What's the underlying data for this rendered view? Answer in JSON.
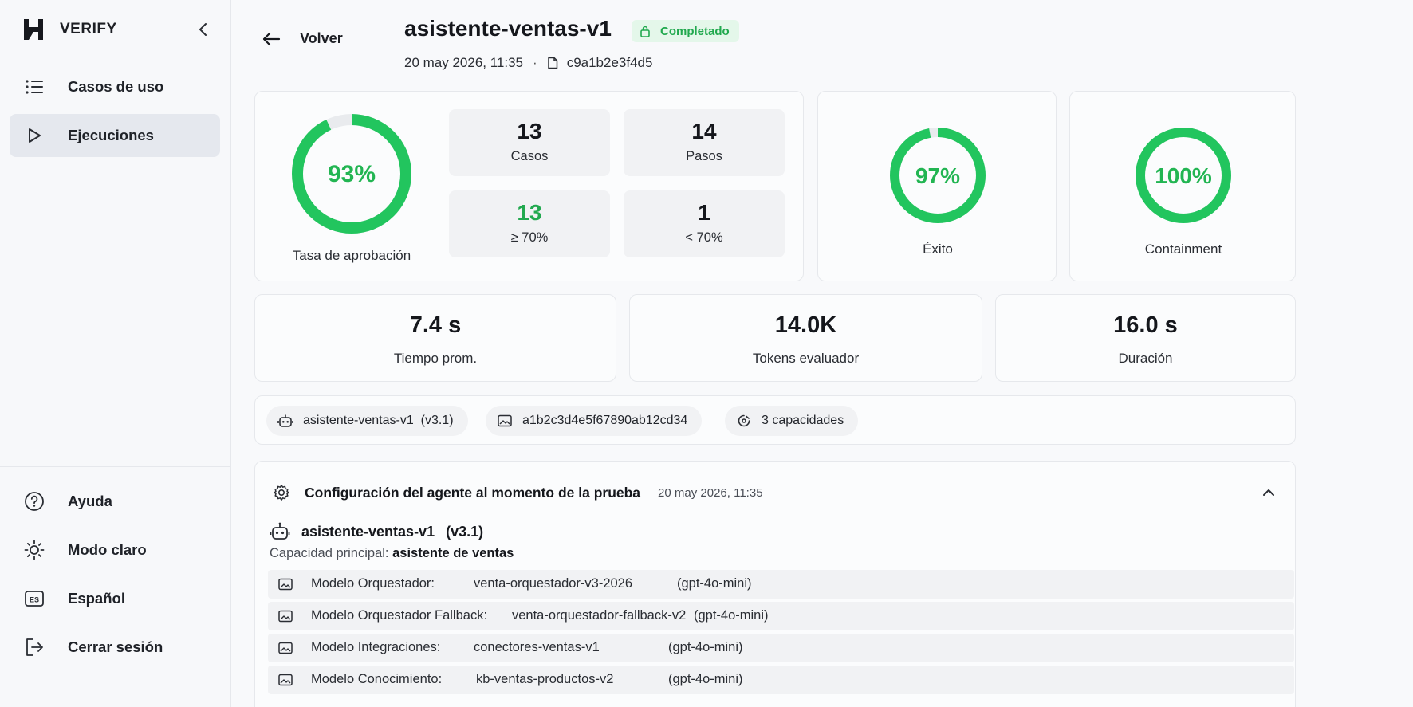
{
  "app": {
    "brand": "VERIFY"
  },
  "sidebar": {
    "items": [
      {
        "label": "Casos de uso",
        "icon": "list-icon",
        "active": false
      },
      {
        "label": "Ejecuciones",
        "icon": "play-icon",
        "active": true
      }
    ],
    "footer": [
      {
        "label": "Ayuda",
        "icon": "help-icon"
      },
      {
        "label": "Modo claro",
        "icon": "sun-icon"
      },
      {
        "label": "Español",
        "icon": "language-icon"
      },
      {
        "label": "Cerrar sesión",
        "icon": "logout-icon"
      }
    ]
  },
  "header": {
    "back_label": "Volver",
    "title": "asistente-ventas-v1",
    "status": "Completado",
    "date": "20 may 2026, 11:35",
    "separator": "·",
    "hash": "c9a1b2e3f4d5"
  },
  "summary": {
    "approval": {
      "value": "93%",
      "fraction": 0.93,
      "label": "Tasa de aprobación"
    },
    "tiles": [
      {
        "value": "13",
        "label": "Casos",
        "color": "default"
      },
      {
        "value": "14",
        "label": "Pasos",
        "color": "default"
      },
      {
        "value": "13",
        "label": "≥ 70%",
        "color": "green"
      },
      {
        "value": "1",
        "label": "< 70%",
        "color": "default"
      }
    ],
    "success": {
      "value": "97%",
      "fraction": 0.97,
      "label": "Éxito"
    },
    "containment": {
      "value": "100%",
      "fraction": 1.0,
      "label": "Containment"
    }
  },
  "metrics": [
    {
      "value": "7.4 s",
      "label": "Tiempo prom."
    },
    {
      "value": "14.0K",
      "label": "Tokens evaluador"
    },
    {
      "value": "16.0 s",
      "label": "Duración"
    }
  ],
  "chips": [
    {
      "label": "asistente-ventas-v1  (v3.1)",
      "icon": "robot-icon"
    },
    {
      "label": "a1b2c3d4e5f67890ab12cd34",
      "icon": "image-icon"
    },
    {
      "label": "3 capacidades",
      "icon": "capability-icon"
    }
  ],
  "config": {
    "title": "Configuración del agente al momento de la prueba",
    "date": "20 may 2026, 11:35",
    "agent_name": "asistente-ventas-v1",
    "agent_version": "(v3.1)",
    "capacity_label": "Capacidad principal:",
    "capacity_value": "asistente de ventas",
    "models": [
      {
        "label": "Modelo Orquestador:",
        "id": "venta-orquestador-v3-2026",
        "base": "(gpt-4o-mini)"
      },
      {
        "label": "Modelo Orquestador Fallback:",
        "id": "venta-orquestador-fallback-v2",
        "base": "(gpt-4o-mini)"
      },
      {
        "label": "Modelo Integraciones:",
        "id": "conectores-ventas-v1",
        "base": "(gpt-4o-mini)"
      },
      {
        "label": "Modelo Conocimiento:",
        "id": "kb-ventas-productos-v2",
        "base": "(gpt-4o-mini)"
      }
    ]
  },
  "colors": {
    "accent_green": "#22c55e",
    "ring_track": "#e9ebee",
    "active_nav": "#e5e8ee"
  }
}
